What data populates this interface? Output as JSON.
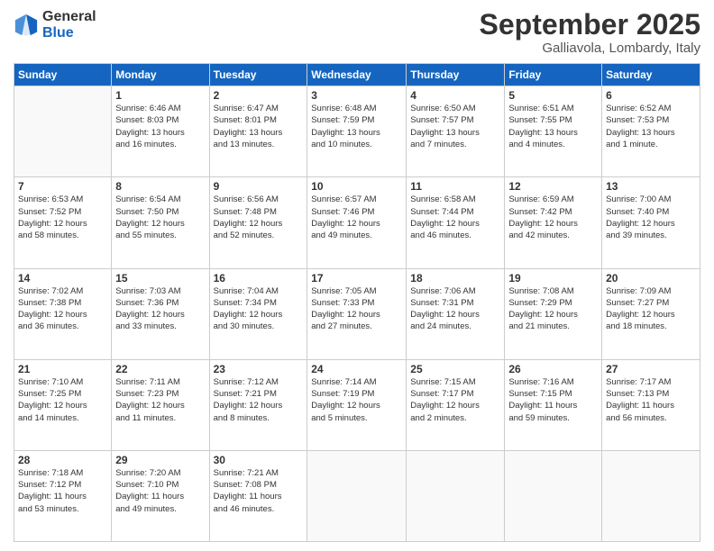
{
  "logo": {
    "general": "General",
    "blue": "Blue"
  },
  "header": {
    "month": "September 2025",
    "location": "Galliavola, Lombardy, Italy"
  },
  "weekdays": [
    "Sunday",
    "Monday",
    "Tuesday",
    "Wednesday",
    "Thursday",
    "Friday",
    "Saturday"
  ],
  "weeks": [
    [
      {
        "day": "",
        "info": ""
      },
      {
        "day": "1",
        "info": "Sunrise: 6:46 AM\nSunset: 8:03 PM\nDaylight: 13 hours\nand 16 minutes."
      },
      {
        "day": "2",
        "info": "Sunrise: 6:47 AM\nSunset: 8:01 PM\nDaylight: 13 hours\nand 13 minutes."
      },
      {
        "day": "3",
        "info": "Sunrise: 6:48 AM\nSunset: 7:59 PM\nDaylight: 13 hours\nand 10 minutes."
      },
      {
        "day": "4",
        "info": "Sunrise: 6:50 AM\nSunset: 7:57 PM\nDaylight: 13 hours\nand 7 minutes."
      },
      {
        "day": "5",
        "info": "Sunrise: 6:51 AM\nSunset: 7:55 PM\nDaylight: 13 hours\nand 4 minutes."
      },
      {
        "day": "6",
        "info": "Sunrise: 6:52 AM\nSunset: 7:53 PM\nDaylight: 13 hours\nand 1 minute."
      }
    ],
    [
      {
        "day": "7",
        "info": "Sunrise: 6:53 AM\nSunset: 7:52 PM\nDaylight: 12 hours\nand 58 minutes."
      },
      {
        "day": "8",
        "info": "Sunrise: 6:54 AM\nSunset: 7:50 PM\nDaylight: 12 hours\nand 55 minutes."
      },
      {
        "day": "9",
        "info": "Sunrise: 6:56 AM\nSunset: 7:48 PM\nDaylight: 12 hours\nand 52 minutes."
      },
      {
        "day": "10",
        "info": "Sunrise: 6:57 AM\nSunset: 7:46 PM\nDaylight: 12 hours\nand 49 minutes."
      },
      {
        "day": "11",
        "info": "Sunrise: 6:58 AM\nSunset: 7:44 PM\nDaylight: 12 hours\nand 46 minutes."
      },
      {
        "day": "12",
        "info": "Sunrise: 6:59 AM\nSunset: 7:42 PM\nDaylight: 12 hours\nand 42 minutes."
      },
      {
        "day": "13",
        "info": "Sunrise: 7:00 AM\nSunset: 7:40 PM\nDaylight: 12 hours\nand 39 minutes."
      }
    ],
    [
      {
        "day": "14",
        "info": "Sunrise: 7:02 AM\nSunset: 7:38 PM\nDaylight: 12 hours\nand 36 minutes."
      },
      {
        "day": "15",
        "info": "Sunrise: 7:03 AM\nSunset: 7:36 PM\nDaylight: 12 hours\nand 33 minutes."
      },
      {
        "day": "16",
        "info": "Sunrise: 7:04 AM\nSunset: 7:34 PM\nDaylight: 12 hours\nand 30 minutes."
      },
      {
        "day": "17",
        "info": "Sunrise: 7:05 AM\nSunset: 7:33 PM\nDaylight: 12 hours\nand 27 minutes."
      },
      {
        "day": "18",
        "info": "Sunrise: 7:06 AM\nSunset: 7:31 PM\nDaylight: 12 hours\nand 24 minutes."
      },
      {
        "day": "19",
        "info": "Sunrise: 7:08 AM\nSunset: 7:29 PM\nDaylight: 12 hours\nand 21 minutes."
      },
      {
        "day": "20",
        "info": "Sunrise: 7:09 AM\nSunset: 7:27 PM\nDaylight: 12 hours\nand 18 minutes."
      }
    ],
    [
      {
        "day": "21",
        "info": "Sunrise: 7:10 AM\nSunset: 7:25 PM\nDaylight: 12 hours\nand 14 minutes."
      },
      {
        "day": "22",
        "info": "Sunrise: 7:11 AM\nSunset: 7:23 PM\nDaylight: 12 hours\nand 11 minutes."
      },
      {
        "day": "23",
        "info": "Sunrise: 7:12 AM\nSunset: 7:21 PM\nDaylight: 12 hours\nand 8 minutes."
      },
      {
        "day": "24",
        "info": "Sunrise: 7:14 AM\nSunset: 7:19 PM\nDaylight: 12 hours\nand 5 minutes."
      },
      {
        "day": "25",
        "info": "Sunrise: 7:15 AM\nSunset: 7:17 PM\nDaylight: 12 hours\nand 2 minutes."
      },
      {
        "day": "26",
        "info": "Sunrise: 7:16 AM\nSunset: 7:15 PM\nDaylight: 11 hours\nand 59 minutes."
      },
      {
        "day": "27",
        "info": "Sunrise: 7:17 AM\nSunset: 7:13 PM\nDaylight: 11 hours\nand 56 minutes."
      }
    ],
    [
      {
        "day": "28",
        "info": "Sunrise: 7:18 AM\nSunset: 7:12 PM\nDaylight: 11 hours\nand 53 minutes."
      },
      {
        "day": "29",
        "info": "Sunrise: 7:20 AM\nSunset: 7:10 PM\nDaylight: 11 hours\nand 49 minutes."
      },
      {
        "day": "30",
        "info": "Sunrise: 7:21 AM\nSunset: 7:08 PM\nDaylight: 11 hours\nand 46 minutes."
      },
      {
        "day": "",
        "info": ""
      },
      {
        "day": "",
        "info": ""
      },
      {
        "day": "",
        "info": ""
      },
      {
        "day": "",
        "info": ""
      }
    ]
  ]
}
